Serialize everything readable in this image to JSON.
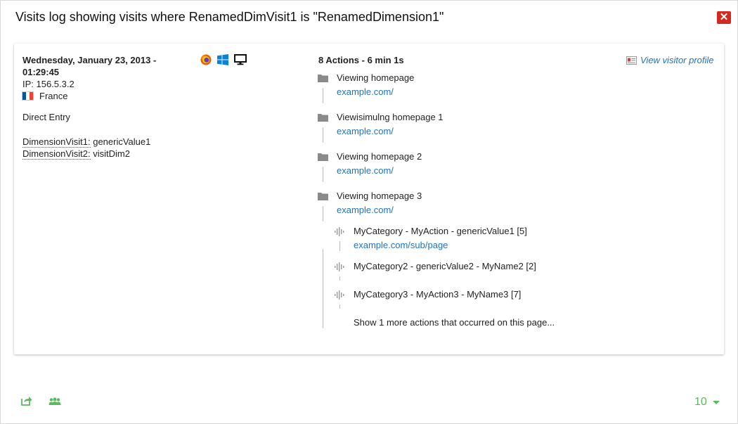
{
  "dialog": {
    "title": "Visits log showing visits where RenamedDimVisit1 is \"RenamedDimension1\"",
    "close_icon": "close-icon"
  },
  "visit": {
    "date": "Wednesday, January 23, 2013 - 01:29:45",
    "ip": "IP: 156.5.3.2",
    "country": "France",
    "flag_colors": [
      "#0055a4",
      "#ffffff",
      "#ef4135"
    ],
    "referrer": "Direct Entry",
    "dimensions": [
      {
        "key": "DimensionVisit1:",
        "value": "genericValue1"
      },
      {
        "key": "DimensionVisit2:",
        "value": "visitDim2"
      }
    ],
    "icons": [
      "firefox-icon",
      "windows-icon",
      "desktop-icon"
    ]
  },
  "actions": {
    "summary": "8 Actions - 6 min 1s",
    "profile_link": "View visitor profile",
    "pages": [
      {
        "title": "Viewing homepage",
        "url": "example.com/"
      },
      {
        "title": "Viewisimulng homepage 1",
        "url": "example.com/"
      },
      {
        "title": "Viewing homepage 2",
        "url": "example.com/"
      },
      {
        "title": "Viewing homepage 3",
        "url": "example.com/"
      }
    ],
    "events": [
      {
        "title": "MyCategory - MyAction - genericValue1 [5]",
        "url": "example.com/sub/page"
      },
      {
        "title": "MyCategory2 - genericValue2 - MyName2 [2]",
        "url": ""
      },
      {
        "title": "MyCategory3 - MyAction3 - MyName3 [7]",
        "url": ""
      }
    ],
    "more": "Show 1 more actions that occurred on this page..."
  },
  "footer": {
    "icons": [
      "export-icon",
      "segment-visitors-icon"
    ],
    "limit": "10",
    "accent": "#5cb85c"
  }
}
